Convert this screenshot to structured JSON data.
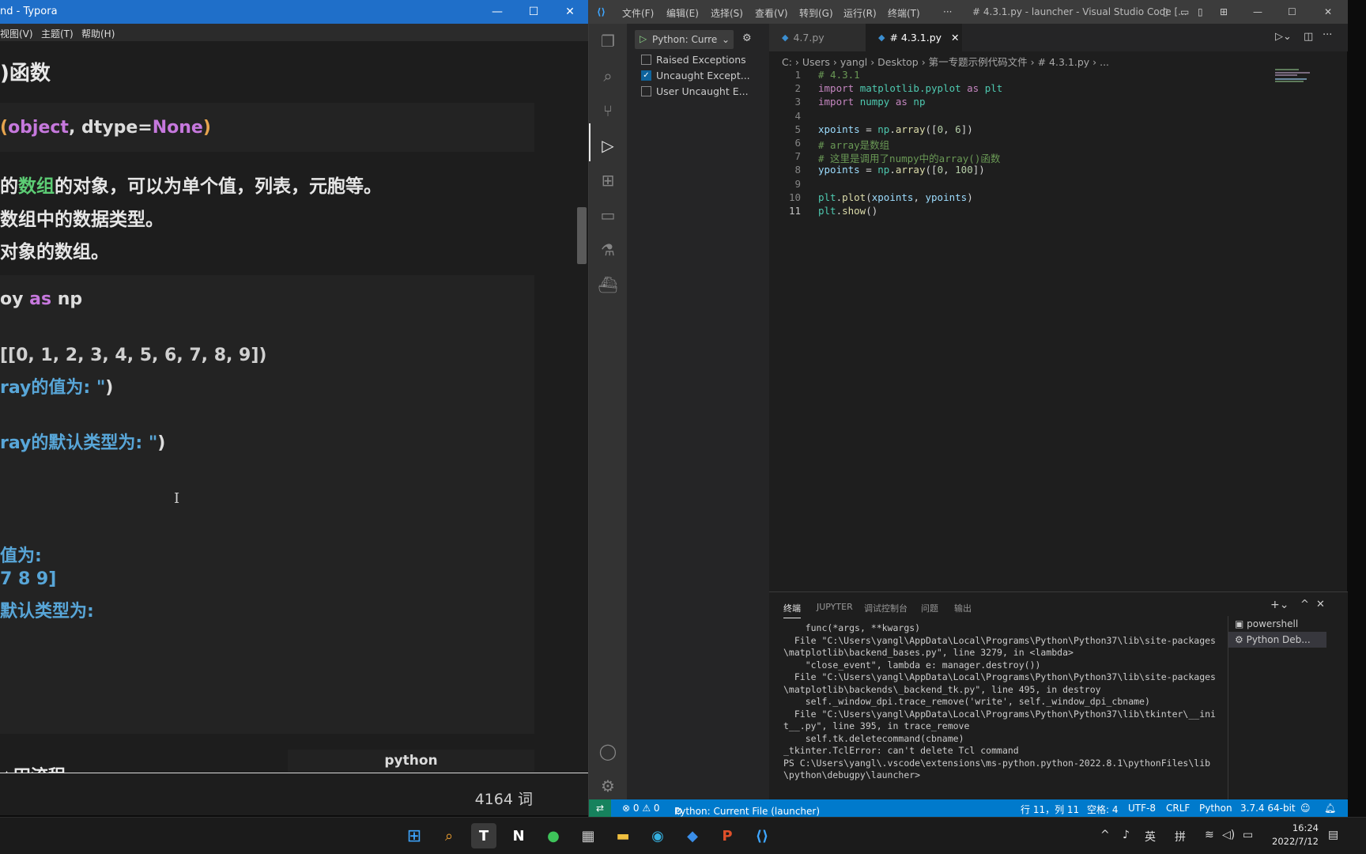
{
  "typora": {
    "window_title": "nd - Typora",
    "menu": [
      "视图(V)",
      "主题(T)",
      "帮助(H)"
    ],
    "heading_fragment": ")函数",
    "signature": {
      "open": "(",
      "object": "object",
      "comma": ", ",
      "dtype": "dtype",
      "eq": "=",
      "none": "None",
      "close": ")"
    },
    "desc_lines": [
      {
        "prefix": "的",
        "highlight": "数组",
        "rest": "的对象，可以为单个值，列表，元胞等。"
      },
      {
        "text": "数组中的数据类型。"
      },
      {
        "text": "对象的数组。"
      }
    ],
    "code_import": {
      "pre": "oy ",
      "kw": "as",
      "post": " np"
    },
    "code_array": "[[0, 1, 2, 3, 4, 5, 6, 7, 8, 9])",
    "code_print1": {
      "str": "ray的值为: \"",
      "close": ")"
    },
    "code_print2": {
      "str": "ray的默认类型为: \"",
      "close": ")"
    },
    "output_lines": [
      "值为:",
      " 7 8 9]",
      "默认类型为:"
    ],
    "code_lang": "python",
    "bottom_heading_fragment": "△田流程",
    "word_count": "4164 词"
  },
  "vscode": {
    "window_title": "# 4.3.1.py - launcher - Visual Studio Code [...",
    "menu": [
      "文件(F)",
      "编辑(E)",
      "选择(S)",
      "查看(V)",
      "转到(G)",
      "运行(R)",
      "终端(T)",
      "···"
    ],
    "debug_config": "Python: Curre",
    "breakpoints": [
      {
        "label": "Raised Exceptions",
        "checked": false
      },
      {
        "label": "Uncaught Except...",
        "checked": true
      },
      {
        "label": "User Uncaught E...",
        "checked": false
      }
    ],
    "tabs": [
      {
        "label": "4.7.py",
        "active": false
      },
      {
        "label": "# 4.3.1.py",
        "active": true
      }
    ],
    "breadcrumb": "C: › Users › yangl › Desktop › 第一专题示例代码文件 › # 4.3.1.py › ...",
    "code_lines": [
      {
        "n": "1",
        "tokens": [
          [
            "c-com",
            "# 4.3.1"
          ]
        ]
      },
      {
        "n": "2",
        "tokens": [
          [
            "c-kw",
            "import "
          ],
          [
            "c-mod",
            "matplotlib.pyplot "
          ],
          [
            "c-kw",
            "as "
          ],
          [
            "c-mod",
            "plt"
          ]
        ]
      },
      {
        "n": "3",
        "tokens": [
          [
            "c-kw",
            "import "
          ],
          [
            "c-mod",
            "numpy "
          ],
          [
            "c-kw",
            "as "
          ],
          [
            "c-mod",
            "np"
          ]
        ]
      },
      {
        "n": "4",
        "tokens": []
      },
      {
        "n": "5",
        "tokens": [
          [
            "c-var",
            "xpoints"
          ],
          [
            "",
            " = "
          ],
          [
            "c-mod",
            "np"
          ],
          [
            "",
            "."
          ],
          [
            "c-fn",
            "array"
          ],
          [
            "",
            "(["
          ],
          [
            "c-num",
            "0"
          ],
          [
            "",
            ", "
          ],
          [
            "c-num",
            "6"
          ],
          [
            "",
            "])"
          ]
        ]
      },
      {
        "n": "6",
        "tokens": [
          [
            "c-com",
            "# array是数组"
          ]
        ]
      },
      {
        "n": "7",
        "tokens": [
          [
            "c-com",
            "# 这里是调用了numpy中的array()函数"
          ]
        ]
      },
      {
        "n": "8",
        "tokens": [
          [
            "c-var",
            "ypoints"
          ],
          [
            "",
            " = "
          ],
          [
            "c-mod",
            "np"
          ],
          [
            "",
            "."
          ],
          [
            "c-fn",
            "array"
          ],
          [
            "",
            "(["
          ],
          [
            "c-num",
            "0"
          ],
          [
            "",
            ", "
          ],
          [
            "c-num",
            "100"
          ],
          [
            "",
            "])"
          ]
        ]
      },
      {
        "n": "9",
        "tokens": []
      },
      {
        "n": "10",
        "tokens": [
          [
            "c-mod",
            "plt"
          ],
          [
            "",
            "."
          ],
          [
            "c-fn",
            "plot"
          ],
          [
            "",
            "("
          ],
          [
            "c-var",
            "xpoints"
          ],
          [
            "",
            ", "
          ],
          [
            "c-var",
            "ypoints"
          ],
          [
            "",
            ")"
          ]
        ]
      },
      {
        "n": "11",
        "tokens": [
          [
            "c-mod",
            "plt"
          ],
          [
            "",
            "."
          ],
          [
            "c-fn",
            "show"
          ],
          [
            "",
            "()"
          ]
        ]
      }
    ],
    "panel_tabs": [
      "终端",
      "JUPYTER",
      "调试控制台",
      "问题",
      "输出"
    ],
    "terminal_text": "    func(*args, **kwargs)\n  File \"C:\\Users\\yangl\\AppData\\Local\\Programs\\Python\\Python37\\lib\\site-packages\\matplotlib\\backend_bases.py\", line 3279, in <lambda>\n    \"close_event\", lambda e: manager.destroy())\n  File \"C:\\Users\\yangl\\AppData\\Local\\Programs\\Python\\Python37\\lib\\site-packages\\matplotlib\\backends\\_backend_tk.py\", line 495, in destroy\n    self._window_dpi.trace_remove('write', self._window_dpi_cbname)\n  File \"C:\\Users\\yangl\\AppData\\Local\\Programs\\Python\\Python37\\lib\\tkinter\\__init__.py\", line 395, in trace_remove\n    self.tk.deletecommand(cbname)\n_tkinter.TclError: can't delete Tcl command\nPS C:\\Users\\yangl\\.vscode\\extensions\\ms-python.python-2022.8.1\\pythonFiles\\lib\\python\\debugpy\\launcher>",
    "terminals": [
      {
        "label": "powershell",
        "selected": false
      },
      {
        "label": "Python Deb...",
        "selected": true
      }
    ],
    "status": {
      "problems": "⊗ 0 ⚠ 0",
      "debug": "Python: Current File (launcher)",
      "position": "行 11，列 11",
      "spaces": "空格: 4",
      "encoding": "UTF-8",
      "eol": "CRLF",
      "language": "Python",
      "interpreter": "3.7.4 64-bit"
    }
  },
  "taskbar": {
    "apps": [
      "windows-start",
      "search",
      "typora",
      "notion",
      "wechat",
      "calculator",
      "file-explorer",
      "edge",
      "whiteboard",
      "powerpoint",
      "vscode"
    ],
    "ime_lang": "英",
    "ime_mode": "拼",
    "time": "16:24",
    "date": "2022/7/12"
  }
}
